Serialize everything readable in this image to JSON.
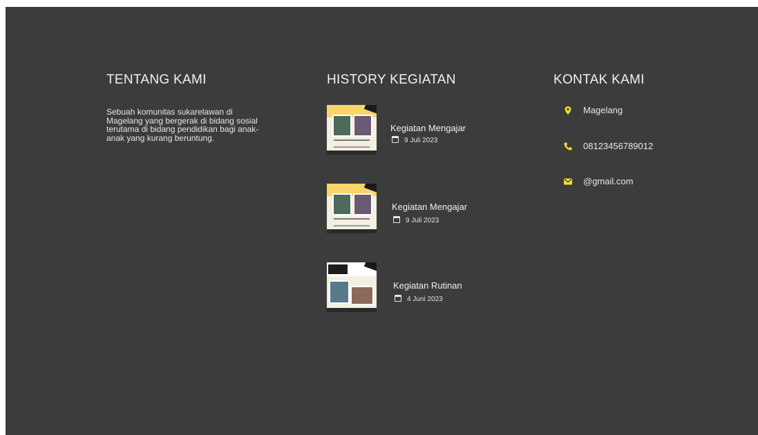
{
  "colors": {
    "background": "#3c3c3c",
    "accent": "#f4e12a",
    "text": "#f0f0f0"
  },
  "about": {
    "heading": "TENTANG KAMI",
    "text": "Sebuah komunitas sukarelawan di Magelang yang bergerak di bidang sosial terutama di bidang pendidikan bagi anak-anak yang kurang beruntung."
  },
  "history": {
    "heading": "HISTORY KEGIATAN",
    "items": [
      {
        "title": "Kegiatan Mengajar",
        "date": "9 Juli 2023",
        "icon": "calendar-icon"
      },
      {
        "title": "Kegiatan Mengajar",
        "date": "9 Juli 2023",
        "icon": "calendar-icon"
      },
      {
        "title": "Kegiatan Rutinan",
        "date": "4 Juni 2023",
        "icon": "calendar-icon"
      }
    ]
  },
  "contact": {
    "heading": "KONTAK KAMI",
    "items": [
      {
        "text": "Magelang",
        "icon": "location-pin-icon"
      },
      {
        "text": "08123456789012",
        "icon": "phone-icon"
      },
      {
        "text": "@gmail.com",
        "icon": "mail-icon"
      }
    ]
  }
}
